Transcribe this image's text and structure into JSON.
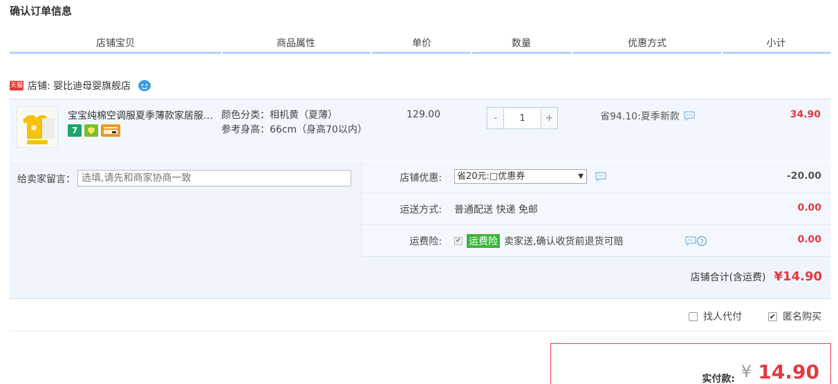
{
  "page_title": "确认订单信息",
  "columns": [
    "店铺宝贝",
    "商品属性",
    "单价",
    "数量",
    "优惠方式",
    "小计"
  ],
  "shop": {
    "badge": "天猫",
    "label": "店铺: 婴比迪母婴旗舰店"
  },
  "item": {
    "title": "宝宝纯棉空调服夏季薄款家居服…",
    "prop_color": "颜色分类：相机黄（夏薄）",
    "prop_height": "参考身高：66cm（身高70以内）",
    "price": "129.00",
    "quantity": "1",
    "minus_label": "-",
    "plus_label": "+",
    "promo": "省94.10:夏季新款",
    "subtotal": "34.90",
    "service_icons": [
      "seven-day-return-icon",
      "guarantee-icon",
      "credit-card-icon"
    ]
  },
  "message": {
    "label": "给卖家留言：",
    "placeholder": "选填,请先和商家协商一致"
  },
  "options": {
    "coupon_label": "店铺优惠:",
    "coupon_value": "省20元:□优惠券",
    "coupon_amount": "-20.00",
    "shipping_label": "运送方式:",
    "shipping_value": "普通配送 快递 免邮",
    "shipping_amount": "0.00",
    "insurance_label": "运费险:",
    "insurance_badge": "运费险",
    "insurance_value": "卖家送,确认收货前退货可赔",
    "insurance_amount": "0.00"
  },
  "store_total": {
    "label": "店铺合计(含运费)",
    "value": "¥14.90"
  },
  "extras": {
    "proxy_pay": "找人代付",
    "anonymous": "匿名购买"
  },
  "payment": {
    "label": "实付款:",
    "currency": "¥",
    "amount": "14.90"
  },
  "colors": {
    "accent": "#e4393c",
    "header_line": "#b2d1ff",
    "row_bg": "#f2f7ff"
  }
}
